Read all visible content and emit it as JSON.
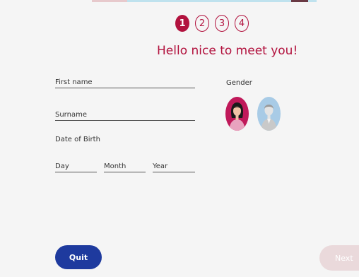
{
  "steps": [
    {
      "label": "1",
      "active": true
    },
    {
      "label": "2",
      "active": false
    },
    {
      "label": "3",
      "active": false
    },
    {
      "label": "4",
      "active": false
    }
  ],
  "greeting": "Hello nice to meet you!",
  "form": {
    "first_name_placeholder": "First name",
    "surname_placeholder": "Surname",
    "dob_label": "Date of Birth",
    "day_placeholder": "Day",
    "month_placeholder": "Month",
    "year_placeholder": "Year",
    "gender_label": "Gender",
    "gender_options": [
      "female-avatar-icon",
      "male-avatar-icon"
    ]
  },
  "buttons": {
    "quit": "Quit",
    "next": "Next"
  },
  "colors": {
    "accent": "#b2123e",
    "primary_button": "#1e3a9e",
    "disabled_button": "#ead9db",
    "female_avatar_bg": "#c0195a",
    "male_avatar_bg": "#a8cbe6"
  }
}
